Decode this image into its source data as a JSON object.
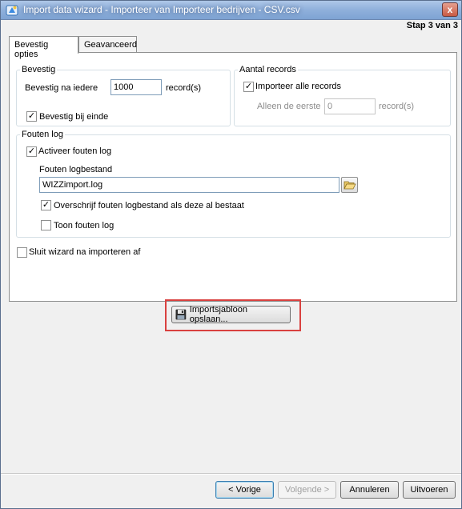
{
  "window": {
    "title": "Import data wizard - Importeer van Importeer bedrijven - CSV.csv",
    "close_label": "x",
    "step": "Stap 3 van 3"
  },
  "tabs": [
    {
      "label": "Bevestig opties",
      "active": true
    },
    {
      "label": "Geavanceerd",
      "active": false
    }
  ],
  "bevestig": {
    "legend": "Bevestig",
    "na_iedere_label": "Bevestig na iedere",
    "na_iedere_value": "1000",
    "unit": "record(s)",
    "bij_einde_label": "Bevestig bij einde",
    "bij_einde_checked": true
  },
  "aantal": {
    "legend": "Aantal records",
    "alle_label": "Importeer alle records",
    "alle_checked": true,
    "eerste_label": "Alleen de eerste",
    "eerste_value": "0",
    "unit": "record(s)"
  },
  "fouten": {
    "legend": "Fouten log",
    "activeer_label": "Activeer fouten log",
    "activeer_checked": true,
    "logbestand_label": "Fouten logbestand",
    "logbestand_value": "WIZZimport.log",
    "overschrijf_label": "Overschrijf fouten logbestand als deze al bestaat",
    "overschrijf_checked": true,
    "toon_label": "Toon fouten log",
    "toon_checked": false
  },
  "sluit": {
    "label": "Sluit wizard na importeren af",
    "checked": false
  },
  "save_template_label": "Importsjabloon opslaan...",
  "footer": {
    "back_label": "< Vorige",
    "next_label": "Volgende >",
    "cancel_label": "Annuleren",
    "execute_label": "Uitvoeren"
  },
  "colors": {
    "highlight": "#d9413f",
    "title_gradient": "#8fb0db"
  }
}
